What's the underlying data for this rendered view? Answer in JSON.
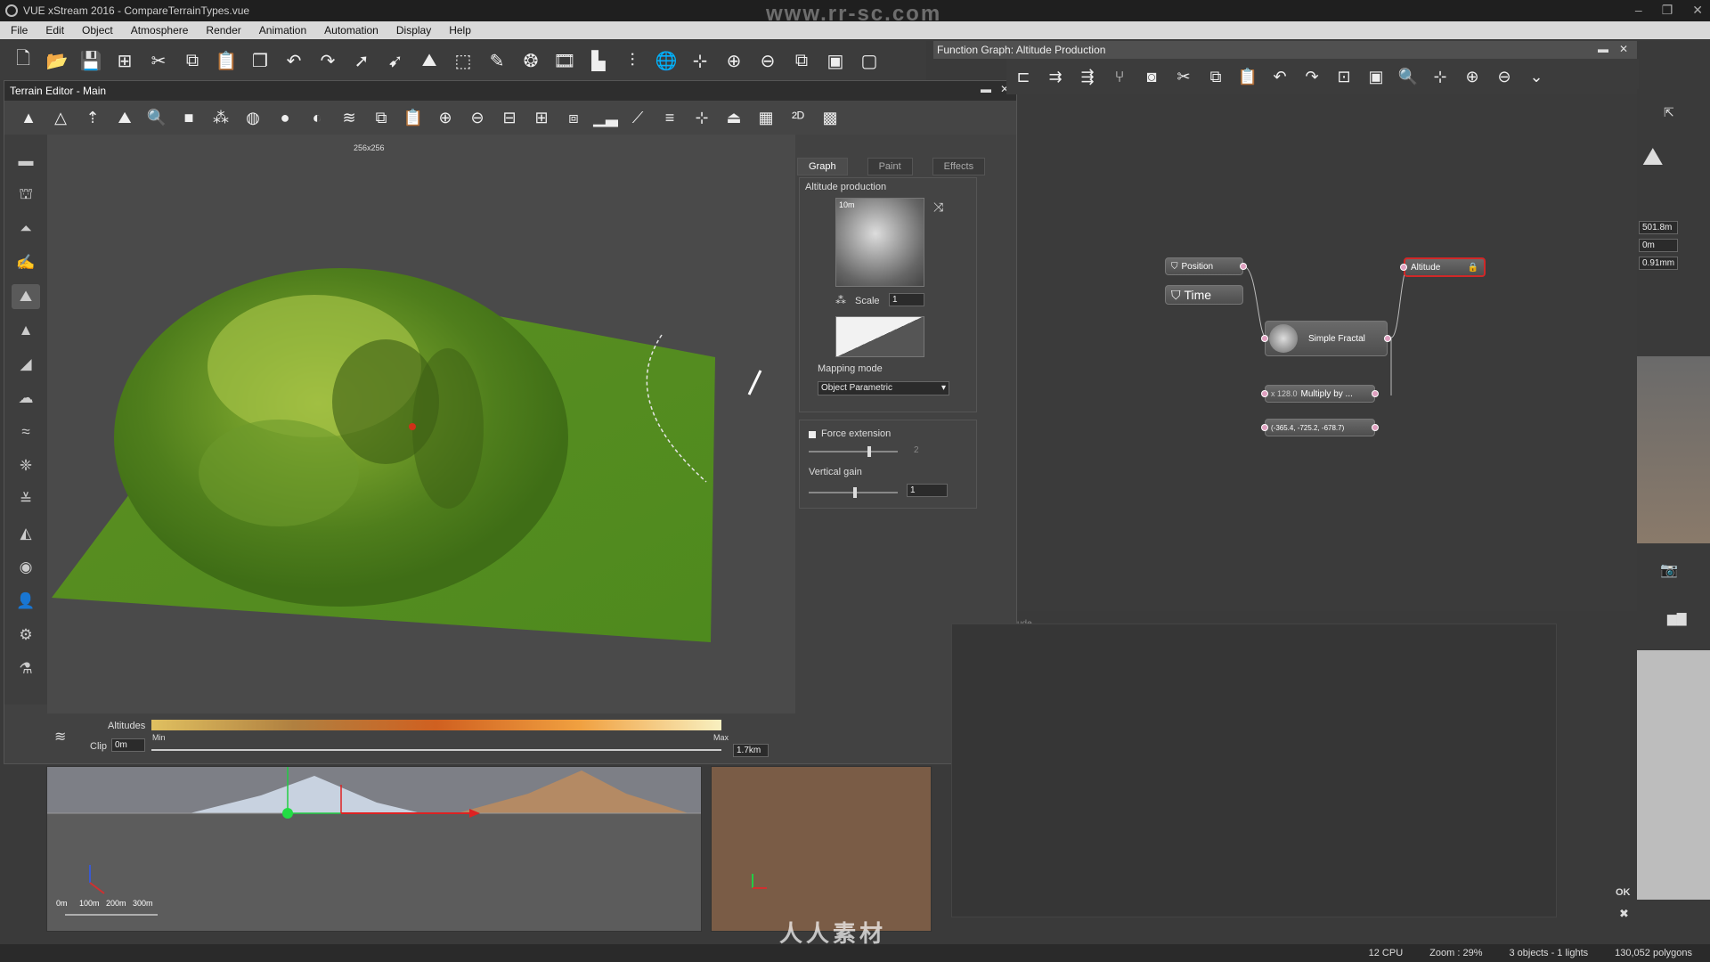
{
  "window": {
    "title": "VUE xStream 2016 - CompareTerrainTypes.vue",
    "watermark": "www.rr-sc.com",
    "bottom_watermark": "人人素材"
  },
  "menu": [
    "File",
    "Edit",
    "Object",
    "Atmosphere",
    "Render",
    "Animation",
    "Automation",
    "Display",
    "Help"
  ],
  "terrain_editor": {
    "title": "Terrain Editor - Main",
    "resolution": "256x256",
    "tabs": [
      "Graph",
      "Paint",
      "Effects"
    ],
    "section_label": "Altitude production",
    "thumb_label": "10m",
    "scale_label": "Scale",
    "scale_value": "1",
    "mapping_mode_label": "Mapping mode",
    "mapping_mode_value": "Object Parametric",
    "force_extension_label": "Force extension",
    "force_extension_value": "2",
    "vertical_gain_label": "Vertical gain",
    "vertical_gain_value": "1",
    "altitudes_label": "Altitudes",
    "clip_label": "Clip",
    "clip_value": "0m",
    "min_label": "Min",
    "max_label": "Max",
    "max_value": "1.7km",
    "ok_label": "OK"
  },
  "function_graph": {
    "title": "Function Graph: Altitude Production",
    "nodes": {
      "position": "Position",
      "time": "Time",
      "altitude": "Altitude",
      "simple_fractal": "Simple Fractal",
      "multiply": "Multiply by ...",
      "multiply_input": "x 128.0",
      "vector": "(-365.4, -725.2, -678.7)"
    },
    "lower_label": "ude",
    "ok_label": "OK"
  },
  "bottom_view": {
    "ruler": [
      "0m",
      "100m",
      "200m",
      "300m"
    ]
  },
  "right_panel": {
    "values": [
      "501.8m",
      "0m",
      "0.91mm"
    ]
  },
  "status": {
    "cpu": "12 CPU",
    "zoom": "Zoom : 29%",
    "objects": "3 objects - 1 lights",
    "polygons": "130,052 polygons"
  }
}
